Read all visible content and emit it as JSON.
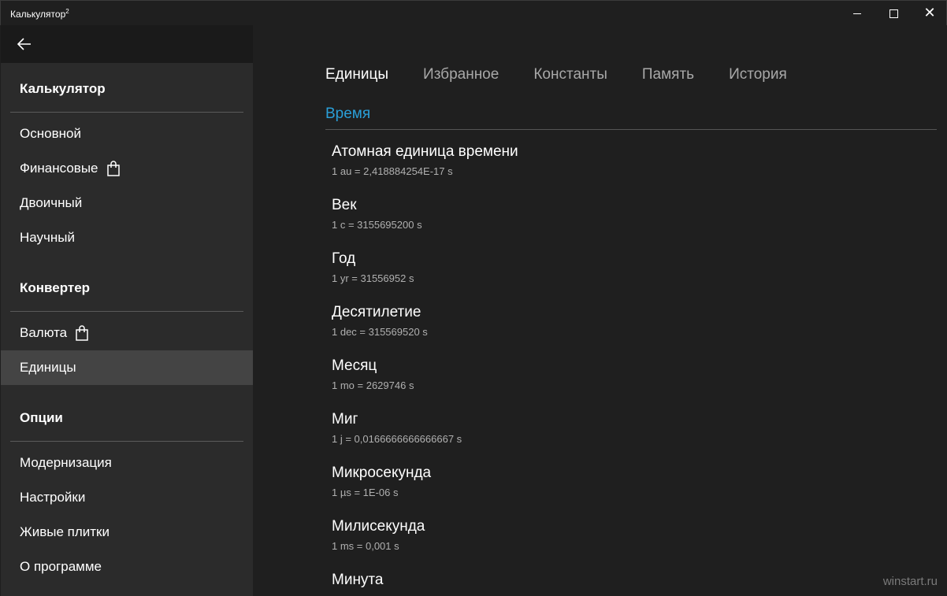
{
  "window": {
    "title": "Калькулятор",
    "title_sup": "2"
  },
  "sidebar": {
    "sections": [
      {
        "title": "Калькулятор",
        "items": [
          {
            "label": "Основной",
            "icon": ""
          },
          {
            "label": "Финансовые",
            "icon": "shopping-bag-icon"
          },
          {
            "label": "Двоичный",
            "icon": ""
          },
          {
            "label": "Научный",
            "icon": ""
          }
        ]
      },
      {
        "title": "Конвертер",
        "items": [
          {
            "label": "Валюта",
            "icon": "shopping-bag-icon"
          },
          {
            "label": "Единицы",
            "icon": "",
            "active": true
          }
        ]
      },
      {
        "title": "Опции",
        "items": [
          {
            "label": "Модернизация",
            "icon": ""
          },
          {
            "label": "Настройки",
            "icon": ""
          },
          {
            "label": "Живые плитки",
            "icon": ""
          },
          {
            "label": "О программе",
            "icon": ""
          }
        ]
      }
    ]
  },
  "tabs": [
    {
      "label": "Единицы",
      "active": true
    },
    {
      "label": "Избранное"
    },
    {
      "label": "Константы"
    },
    {
      "label": "Память"
    },
    {
      "label": "История"
    }
  ],
  "category": "Время",
  "units": [
    {
      "name": "Атомная единица времени",
      "def": "1 au = 2,418884254E-17 s"
    },
    {
      "name": "Век",
      "def": "1 c = 3155695200 s"
    },
    {
      "name": "Год",
      "def": "1 yr = 31556952 s"
    },
    {
      "name": "Десятилетие",
      "def": "1 dec = 315569520 s"
    },
    {
      "name": "Месяц",
      "def": "1 mo = 2629746 s"
    },
    {
      "name": "Миг",
      "def": "1 j = 0,0166666666666667 s"
    },
    {
      "name": "Микросекунда",
      "def": "1 µs = 1E-06 s"
    },
    {
      "name": "Милисекунда",
      "def": "1 ms = 0,001 s"
    },
    {
      "name": "Минута",
      "def": ""
    }
  ],
  "watermark": "winstart.ru",
  "colors": {
    "accent": "#2a9fd8",
    "active_item": "#444444",
    "sidebar": "#2b2b2b"
  }
}
